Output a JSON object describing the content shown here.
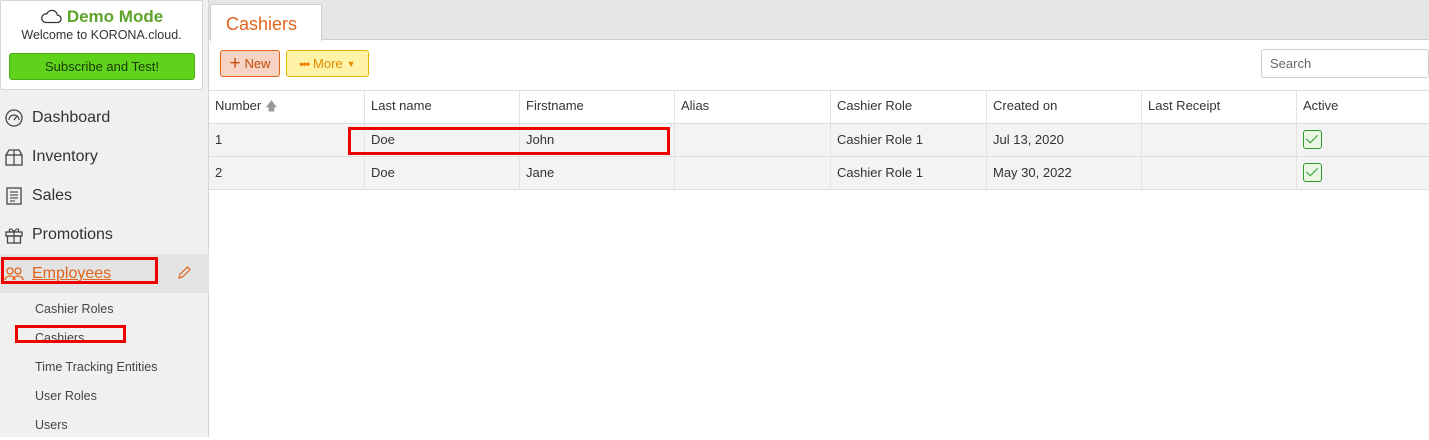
{
  "demo": {
    "title": "Demo Mode",
    "welcome": "Welcome to KORONA.cloud.",
    "subscribe_label": "Subscribe and Test!"
  },
  "nav": {
    "items": [
      {
        "label": "Dashboard",
        "icon": "dashboard-icon"
      },
      {
        "label": "Inventory",
        "icon": "inventory-icon"
      },
      {
        "label": "Sales",
        "icon": "sales-receipt-icon"
      },
      {
        "label": "Promotions",
        "icon": "gift-icon"
      },
      {
        "label": "Employees",
        "icon": "people-icon",
        "active": true
      }
    ],
    "sub_items": [
      {
        "label": "Cashier Roles"
      },
      {
        "label": "Cashiers",
        "selected": true
      },
      {
        "label": "Time Tracking Entities"
      },
      {
        "label": "User Roles"
      },
      {
        "label": "Users"
      }
    ]
  },
  "tab": {
    "label": "Cashiers"
  },
  "toolbar": {
    "new_label": "New",
    "more_label": "More",
    "search_placeholder": "Search"
  },
  "table": {
    "columns": [
      "Number",
      "Last name",
      "Firstname",
      "Alias",
      "Cashier Role",
      "Created on",
      "Last Receipt",
      "Active"
    ],
    "sort_column": "Number",
    "rows": [
      {
        "number": "1",
        "last_name": "Doe",
        "first_name": "John",
        "alias": "",
        "cashier_role": "Cashier Role 1",
        "created_on": "Jul 13, 2020",
        "last_receipt": "",
        "active": true
      },
      {
        "number": "2",
        "last_name": "Doe",
        "first_name": "Jane",
        "alias": "",
        "cashier_role": "Cashier Role 1",
        "created_on": "May 30, 2022",
        "last_receipt": "",
        "active": true
      }
    ]
  },
  "colors": {
    "accent_orange": "#e2641b",
    "demo_green": "#5ea32a",
    "subscribe_green": "#5fd31c",
    "highlight_red": "#ee0000",
    "check_green": "#2d9a2d"
  }
}
